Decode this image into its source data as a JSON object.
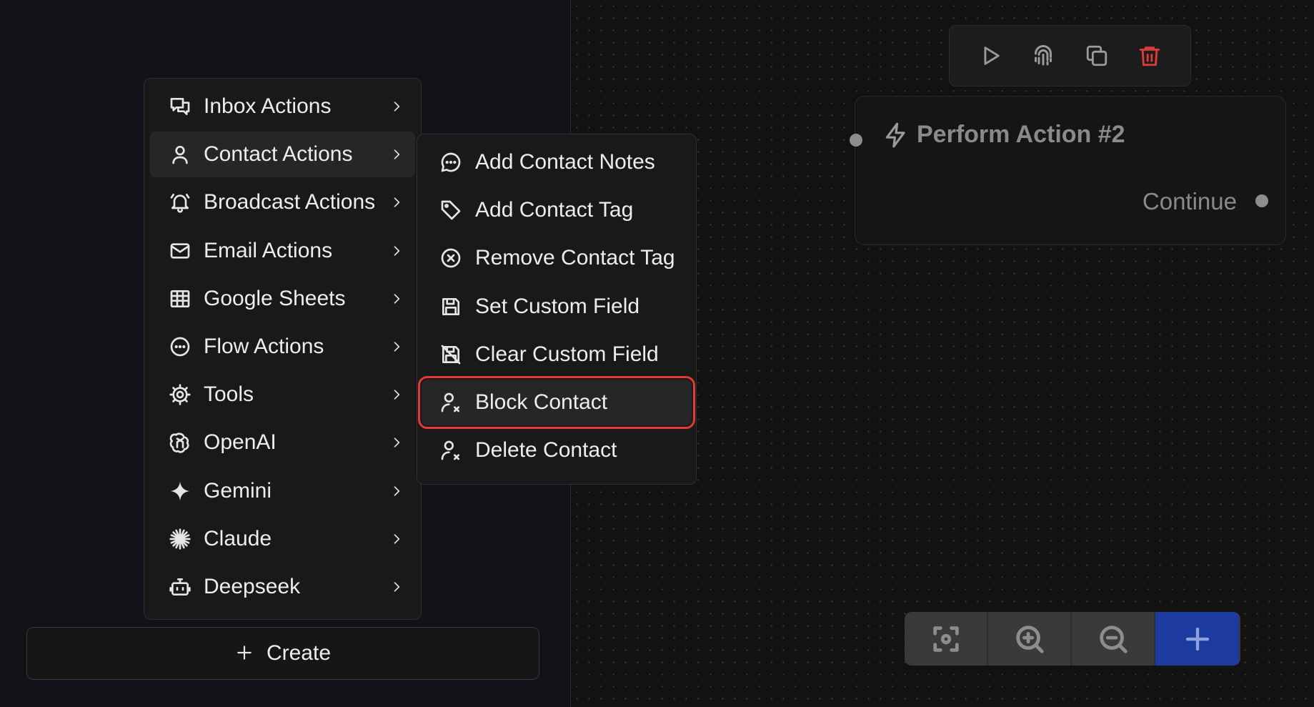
{
  "menu": {
    "items": [
      {
        "label": "Inbox Actions",
        "icon": "chat-bubbles-icon"
      },
      {
        "label": "Contact Actions",
        "icon": "user-icon"
      },
      {
        "label": "Broadcast Actions",
        "icon": "bell-icon"
      },
      {
        "label": "Email Actions",
        "icon": "mail-icon"
      },
      {
        "label": "Google Sheets",
        "icon": "table-icon"
      },
      {
        "label": "Flow Actions",
        "icon": "dots-circle-icon"
      },
      {
        "label": "Tools",
        "icon": "gear-icon"
      },
      {
        "label": "OpenAI",
        "icon": "openai-icon"
      },
      {
        "label": "Gemini",
        "icon": "sparkle-icon"
      },
      {
        "label": "Claude",
        "icon": "claude-icon"
      },
      {
        "label": "Deepseek",
        "icon": "robot-icon"
      }
    ],
    "active_item": "Contact Actions"
  },
  "submenu": {
    "items": [
      {
        "label": "Add Contact Notes",
        "icon": "message-dots-icon"
      },
      {
        "label": "Add Contact Tag",
        "icon": "tag-icon"
      },
      {
        "label": "Remove Contact Tag",
        "icon": "x-circle-icon"
      },
      {
        "label": "Set Custom Field",
        "icon": "save-icon"
      },
      {
        "label": "Clear Custom Field",
        "icon": "save-off-icon"
      },
      {
        "label": "Block Contact",
        "icon": "user-x-icon"
      },
      {
        "label": "Delete Contact",
        "icon": "user-x-icon"
      }
    ],
    "highlighted_item": "Block Contact",
    "highlight_color": "#e53935"
  },
  "create_button": {
    "label": "Create"
  },
  "node_toolbar": {
    "buttons": [
      "play-icon",
      "fingerprint-icon",
      "copy-icon",
      "trash-icon"
    ],
    "delete_color": "#dc3c3c"
  },
  "node": {
    "title": "Perform Action #2",
    "output_label": "Continue"
  },
  "controls": {
    "buttons": [
      "fit-view-icon",
      "zoom-in-icon",
      "zoom-out-icon",
      "add-icon"
    ],
    "primary_color": "#1d3aa0"
  }
}
